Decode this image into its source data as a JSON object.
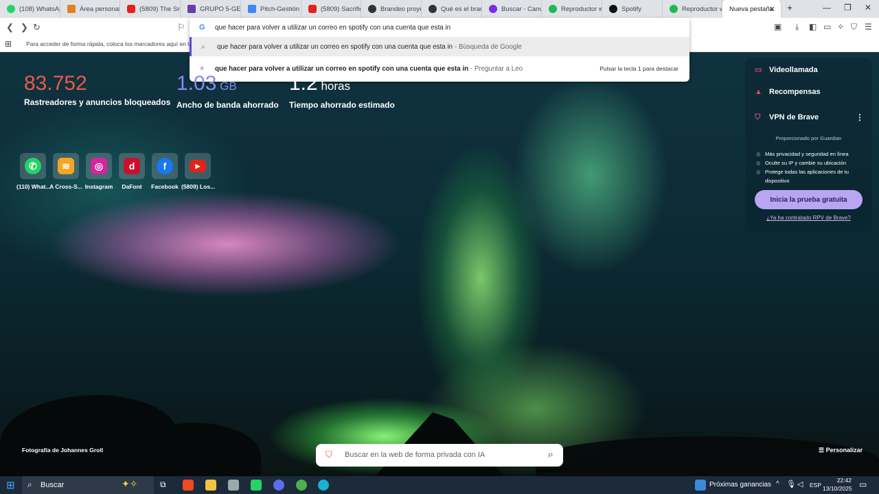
{
  "tabs": [
    {
      "label": "(108) WhatsAp",
      "icon": "whatsapp-icon",
      "color": "#25d366"
    },
    {
      "label": "Área personal",
      "icon": "area-icon",
      "color": "#e0821e"
    },
    {
      "label": "(5809) The Smi",
      "icon": "youtube-icon",
      "color": "#e62117"
    },
    {
      "label": "GRUPO 5-GEST",
      "icon": "twitch-icon",
      "color": "#6441a5"
    },
    {
      "label": "Pitch-Gestión",
      "icon": "docs-icon",
      "color": "#4285f4"
    },
    {
      "label": "(5809) Sacrific",
      "icon": "youtube-icon",
      "color": "#e62117"
    },
    {
      "label": "Brandeo proye",
      "icon": "openai-icon",
      "color": "#333333"
    },
    {
      "label": "Qué es el brand",
      "icon": "openai-icon",
      "color": "#333333"
    },
    {
      "label": "Buscar - Canva",
      "icon": "canva-icon",
      "color": "#7d2ae8"
    },
    {
      "label": "Reproductor w",
      "icon": "spotify-icon",
      "color": "#1db954"
    },
    {
      "label": "Spotify",
      "icon": "spotify-icon",
      "color": "#111111"
    },
    {
      "label": "Reproductor w",
      "icon": "spotify-icon",
      "color": "#1db954"
    },
    {
      "label": "Nueva pestaña",
      "icon": "newtab-icon",
      "color": "#ffffff"
    }
  ],
  "bookmarks_hint": "Para acceder de forma rápida, coloca los marcadores aquí en la bar",
  "omnibox": {
    "query": "que hacer para volver a utilizar un correo en spotify con una cuenta que esta in",
    "suggestion_google_text": "que hacer para volver a utilizar un correo en spotify con una cuenta que esta in",
    "suggestion_google_source": " - Búsqueda de Google",
    "suggestion_leo_text": "que hacer para volver a utilizar un correo en spotify con una cuenta que esta in",
    "suggestion_leo_source": " - Preguntar a Leo",
    "leo_hint": "Pulsar la tecla 1 para destacar"
  },
  "stats": [
    {
      "number": "83.752",
      "unit": "",
      "label": "Rastreadores y anuncios bloqueados",
      "color": "#f0584a"
    },
    {
      "number": "1.03",
      "unit": " GB",
      "label": "Ancho de banda ahorrado",
      "color": "#8a88f0"
    },
    {
      "number": "1.2",
      "unit": " horas",
      "label": "Tiempo ahorrado estimado",
      "color": "#ffffff"
    }
  ],
  "shortcuts": [
    {
      "label": "(110) What...",
      "icon": "whatsapp-icon",
      "color": "#25d366"
    },
    {
      "label": "A Cross-S...",
      "icon": "cross-icon",
      "color": "#f5a623"
    },
    {
      "label": "Instagram",
      "icon": "instagram-icon",
      "color": "#d6249f"
    },
    {
      "label": "DaFont",
      "icon": "dafont-icon",
      "color": "#c8102e"
    },
    {
      "label": "Facebook",
      "icon": "facebook-icon",
      "color": "#1877f2"
    },
    {
      "label": "(5809) Los...",
      "icon": "youtube-icon",
      "color": "#e62117"
    }
  ],
  "panel": {
    "videocall": "Videollamada",
    "rewards": "Recompensas",
    "vpn_title": "VPN de Brave",
    "provided_by": "Proporcionado por  Guardian",
    "bullets": [
      "Más privacidad y seguridad en línea",
      "Oculte su IP y cambie su ubicación",
      "Protege todas las aplicaciones de tu dispositivo"
    ],
    "trial_button": "Inicia la prueba gratuita",
    "contracted_link": "¿Ya ha contratado RPV de Brave?"
  },
  "photo_credit": "Fotografía de Johannes Groll",
  "search_placeholder": "Buscar en la web de forma privada con IA",
  "customize": "Personalizar",
  "taskbar": {
    "search": "Buscar",
    "weather": "Próximas ganancias",
    "lang": "ESP",
    "time": "22:42",
    "date": "13/10/2025"
  }
}
